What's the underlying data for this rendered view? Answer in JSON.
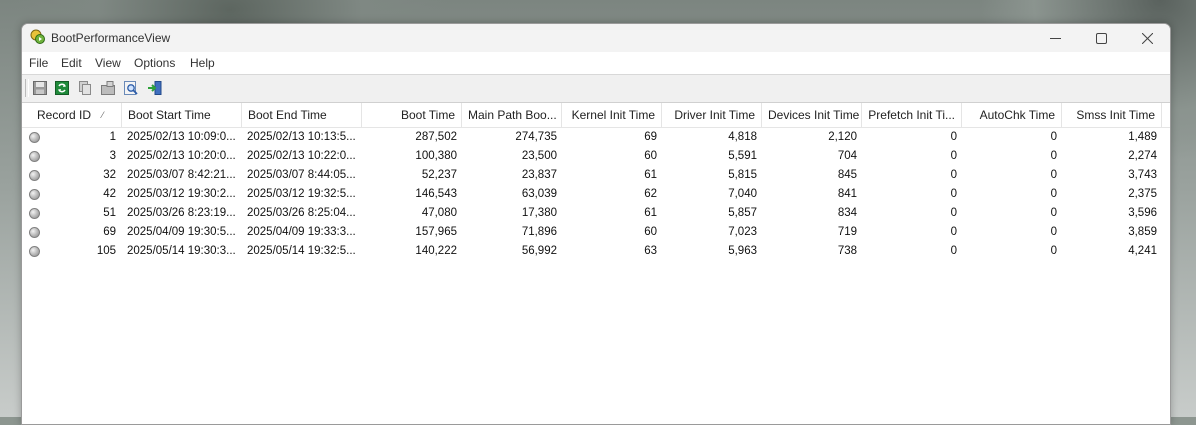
{
  "window": {
    "title": "BootPerformanceView"
  },
  "menu": [
    "File",
    "Edit",
    "View",
    "Options",
    "Help"
  ],
  "toolbar": {
    "buttons": [
      {
        "name": "save-icon"
      },
      {
        "name": "refresh-icon"
      },
      {
        "name": "copy-icon"
      },
      {
        "name": "properties-icon"
      },
      {
        "name": "find-icon"
      },
      {
        "name": "exit-icon"
      }
    ]
  },
  "columns": [
    "Record ID",
    "Boot Start Time",
    "Boot End Time",
    "Boot Time",
    "Main Path Boo...",
    "Kernel Init Time",
    "Driver Init Time",
    "Devices Init Time",
    "Prefetch Init Ti...",
    "AutoChk Time",
    "Smss Init Time"
  ],
  "sort_indicator": "⁄",
  "rows": [
    [
      "1",
      "2025/02/13 10:09:0...",
      "2025/02/13 10:13:5...",
      "287,502",
      "274,735",
      "69",
      "4,818",
      "2,120",
      "0",
      "0",
      "1,489"
    ],
    [
      "3",
      "2025/02/13 10:20:0...",
      "2025/02/13 10:22:0...",
      "100,380",
      "23,500",
      "60",
      "5,591",
      "704",
      "0",
      "0",
      "2,274"
    ],
    [
      "32",
      "2025/03/07 8:42:21...",
      "2025/03/07 8:44:05...",
      "52,237",
      "23,837",
      "61",
      "5,815",
      "845",
      "0",
      "0",
      "3,743"
    ],
    [
      "42",
      "2025/03/12 19:30:2...",
      "2025/03/12 19:32:5...",
      "146,543",
      "63,039",
      "62",
      "7,040",
      "841",
      "0",
      "0",
      "2,375"
    ],
    [
      "51",
      "2025/03/26 8:23:19...",
      "2025/03/26 8:25:04...",
      "47,080",
      "17,380",
      "61",
      "5,857",
      "834",
      "0",
      "0",
      "3,596"
    ],
    [
      "69",
      "2025/04/09 19:30:5...",
      "2025/04/09 19:33:3...",
      "157,965",
      "71,896",
      "60",
      "7,023",
      "719",
      "0",
      "0",
      "3,859"
    ],
    [
      "105",
      "2025/05/14 19:30:3...",
      "2025/05/14 19:32:5...",
      "140,222",
      "56,992",
      "63",
      "5,963",
      "738",
      "0",
      "0",
      "4,241"
    ]
  ]
}
